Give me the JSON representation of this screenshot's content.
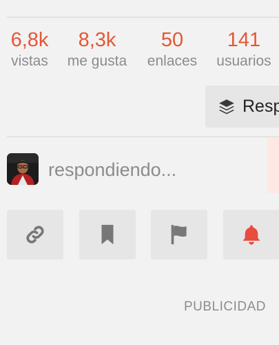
{
  "stats": {
    "views": {
      "value": "6,8k",
      "label": "vistas"
    },
    "likes": {
      "value": "8,3k",
      "label": "me gusta"
    },
    "links": {
      "value": "50",
      "label": "enlaces"
    },
    "users": {
      "value": "141",
      "label": "usuarios"
    }
  },
  "reply_button": {
    "label": "Resp",
    "icon": "layers-icon"
  },
  "presence": {
    "text": "respondiendo...",
    "avatar": "user-avatar"
  },
  "actions": [
    {
      "name": "link-icon",
      "color": "#777777"
    },
    {
      "name": "bookmark-icon",
      "color": "#777777"
    },
    {
      "name": "flag-icon",
      "color": "#777777"
    },
    {
      "name": "bell-icon",
      "color": "#e74c3c"
    }
  ],
  "ad": {
    "label": "PUBLICIDAD"
  },
  "colors": {
    "accent": "#e45735",
    "muted": "#8c8c8c",
    "button_bg": "#e6e6e6"
  }
}
